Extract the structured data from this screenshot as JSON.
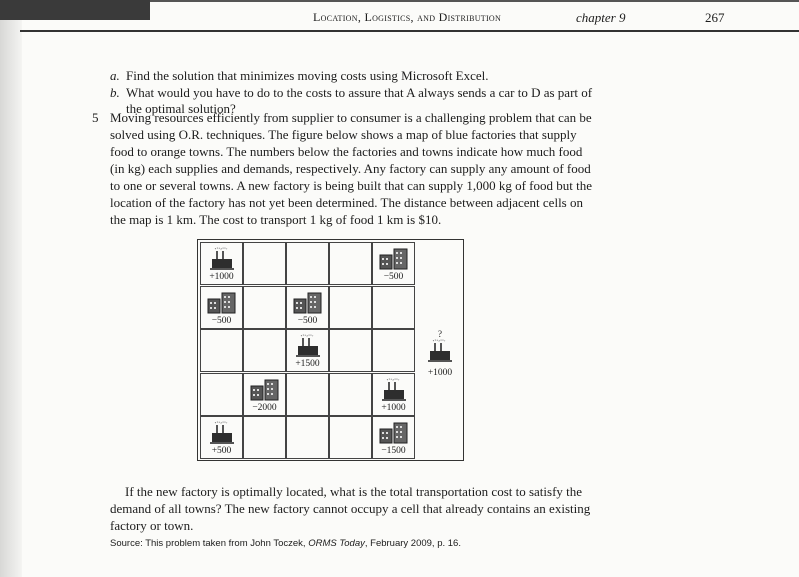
{
  "header": {
    "running_title": "Location, Logistics, and Distribution",
    "chapter": "chapter 9",
    "page_number": "267"
  },
  "items": [
    {
      "label": "a.",
      "lines": [
        "Find the solution that minimizes moving costs using Microsoft Excel."
      ]
    },
    {
      "label": "b.",
      "lines": [
        "What would you have to do to the costs to assure that A always sends a car to D as part of",
        "the optimal solution?"
      ]
    }
  ],
  "problem": {
    "number": "5",
    "lines": [
      "Moving resources efficiently from supplier to consumer is a challenging problem that can be",
      "solved using O.R. techniques. The figure below shows a map of blue factories that supply",
      "food to orange towns. The numbers below the factories and towns indicate how much food",
      "(in kg) each supplies and demands, respectively. Any factory can supply any amount of food",
      "to one or several towns. A new factory is being built that can supply 1,000 kg of food but the",
      "location of the factory has not yet been determined. The distance between adjacent cells on",
      "the map is 1 km. The cost to transport 1 kg of food 1 km is $10."
    ]
  },
  "map": {
    "rows": [
      [
        {
          "type": "factory",
          "value": "+1000"
        },
        {},
        {},
        {},
        {
          "type": "town",
          "value": "−500"
        }
      ],
      [
        {
          "type": "town",
          "value": "−500"
        },
        {},
        {
          "type": "town",
          "value": "−500"
        },
        {},
        {}
      ],
      [
        {},
        {},
        {
          "type": "factory",
          "value": "+1500"
        },
        {},
        {}
      ],
      [
        {},
        {
          "type": "town",
          "value": "−2000"
        },
        {},
        {},
        {
          "type": "factory",
          "value": "+1000"
        }
      ],
      [
        {
          "type": "factory",
          "value": "+500"
        },
        {},
        {},
        {},
        {
          "type": "town",
          "value": "−1500"
        }
      ]
    ],
    "new_factory": {
      "mark": "?",
      "value": "+1000"
    }
  },
  "question": [
    "If the new factory is optimally located, what is the total transportation cost to satisfy the",
    "demand of all towns? The new factory cannot occupy a cell that already contains an existing",
    "factory or town."
  ],
  "source": {
    "prefix": "Source: This problem taken from John Toczek, ",
    "journal": "ORMS Today",
    "suffix": ", February 2009, p. 16."
  }
}
